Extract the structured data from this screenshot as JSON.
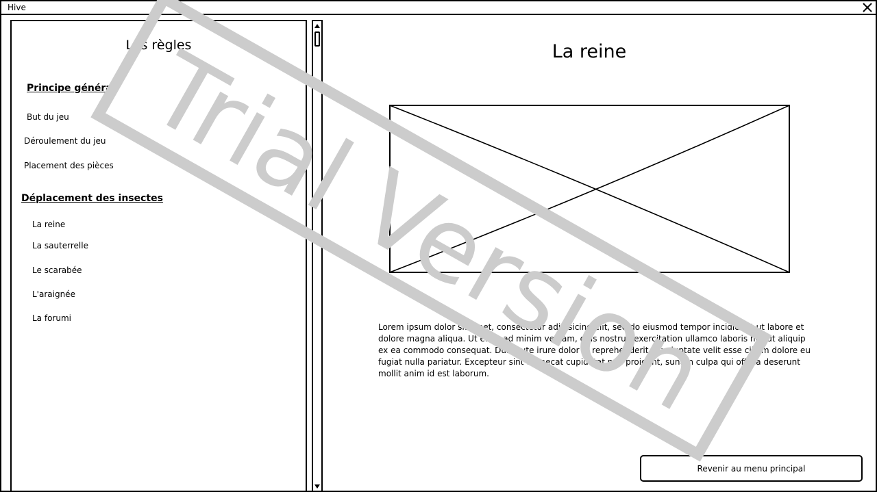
{
  "window": {
    "title": "Hive"
  },
  "sidebar": {
    "title": "Les règles",
    "sections": [
      {
        "heading": "Principe général",
        "items": [
          "But du jeu",
          "Déroulement du jeu",
          "Placement des pièces"
        ]
      },
      {
        "heading": "Déplacement des insectes",
        "items": [
          "La reine",
          "La sauterrelle",
          "Le scarabée",
          "L'araignée",
          "La forumi"
        ]
      }
    ]
  },
  "content": {
    "title": "La reine",
    "body": "Lorem ipsum dolor sit amet, consectetur adipisicing elit, sed do eiusmod tempor incididunt ut labore et dolore magna aliqua. Ut enim ad minim veniam, quis nostrud exercitation ullamco laboris nisi ut aliquip ex ea commodo consequat. Duis aute irure dolor in reprehenderit in voluptate velit esse cillum dolore eu fugiat nulla pariatur. Excepteur sint occaecat cupidatat non proident, sunt in culpa qui officia deserunt mollit anim id est laborum."
  },
  "footer": {
    "back_label": "Revenir au menu principal"
  },
  "watermark": {
    "text": "Trial Version",
    "color": "#cccccc"
  },
  "icons": {
    "close": "close-icon",
    "scroll_up": "arrow-up-icon",
    "scroll_down": "arrow-down-icon"
  }
}
